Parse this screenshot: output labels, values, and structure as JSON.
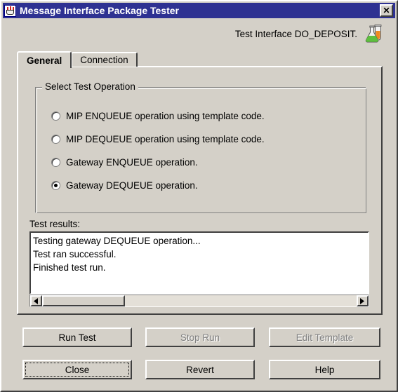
{
  "window": {
    "title": "Message Interface Package Tester",
    "icon": "java-cup-icon",
    "close_label": "✕"
  },
  "header": {
    "interface_text": "Test Interface DO_DEPOSIT.",
    "icon": "flask-icon"
  },
  "tabs": [
    {
      "label": "General",
      "active": true
    },
    {
      "label": "Connection",
      "active": false
    }
  ],
  "group": {
    "title": "Select Test Operation",
    "options": [
      {
        "label": "MIP ENQUEUE operation using template code.",
        "selected": false
      },
      {
        "label": "MIP DEQUEUE operation using template code.",
        "selected": false
      },
      {
        "label": "Gateway ENQUEUE operation.",
        "selected": false
      },
      {
        "label": "Gateway DEQUEUE operation.",
        "selected": true
      }
    ]
  },
  "results": {
    "label": "Test results:",
    "lines": [
      "Testing gateway DEQUEUE operation...",
      "Test ran successful.",
      "Finished test run."
    ],
    "text": "Testing gateway DEQUEUE operation...\nTest ran successful.\nFinished test run.",
    "scrollbar": {
      "left_arrow": "◄",
      "right_arrow": "►"
    }
  },
  "buttons": [
    {
      "label": "Run Test",
      "enabled": true,
      "focused": false
    },
    {
      "label": "Stop Run",
      "enabled": false,
      "focused": false
    },
    {
      "label": "Edit Template",
      "enabled": false,
      "focused": false
    },
    {
      "label": "Close",
      "enabled": true,
      "focused": true
    },
    {
      "label": "Revert",
      "enabled": true,
      "focused": false
    },
    {
      "label": "Help",
      "enabled": true,
      "focused": false
    }
  ],
  "colors": {
    "titlebar": "#2e3192",
    "face": "#d4d0c8",
    "field": "#ffffff",
    "disabled_text": "#808080"
  }
}
